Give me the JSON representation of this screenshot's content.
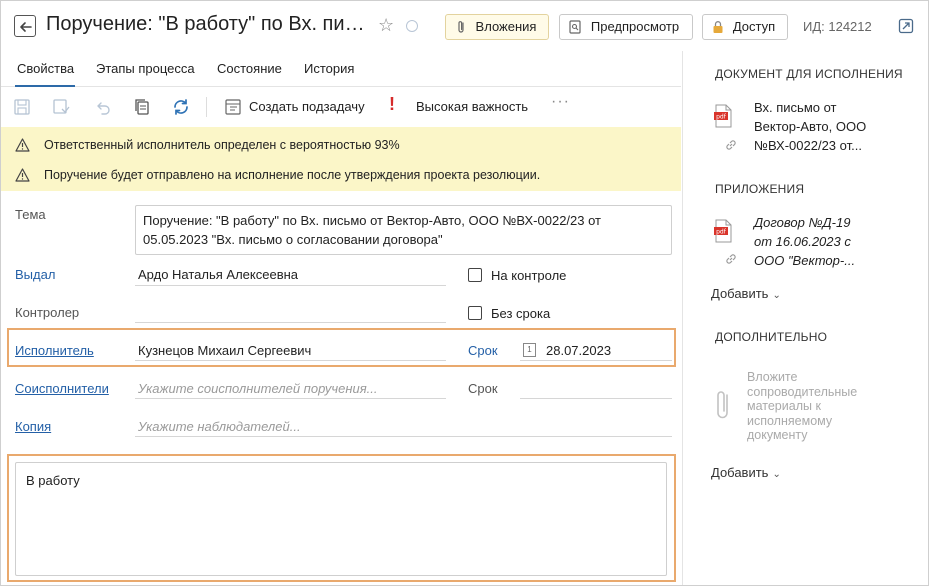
{
  "header": {
    "title": "Поручение: \"В работу\" по Вх. пис...",
    "attachments_label": "Вложения",
    "preview_label": "Предпросмотр",
    "access_label": "Доступ",
    "id_label": "ИД: 124212"
  },
  "tabs": [
    {
      "label": "Свойства",
      "active": true
    },
    {
      "label": "Этапы процесса",
      "active": false
    },
    {
      "label": "Состояние",
      "active": false
    },
    {
      "label": "История",
      "active": false
    }
  ],
  "toolbar": {
    "create_subtask_label": "Создать подзадачу",
    "importance_mark": "!",
    "importance_label": "Высокая важность",
    "more_label": "···"
  },
  "warnings": [
    "Ответственный исполнитель определен с вероятностью 93%",
    "Поручение будет отправлено на исполнение после утверждения проекта резолюции."
  ],
  "form": {
    "subject_label": "Тема",
    "subject_value": "Поручение: \"В работу\" по Вх. письмо от Вектор-Авто, ООО №ВХ-0022/23 от 05.05.2023 \"Вх. письмо о согласовании договора\"",
    "issued_label": "Выдал",
    "issued_value": "Ардо Наталья Алексеевна",
    "on_control_label": "На контроле",
    "controller_label": "Контролер",
    "controller_value": "",
    "no_deadline_label": "Без срока",
    "executor_label": "Исполнитель",
    "executor_value": "Кузнецов Михаил Сергеевич",
    "deadline_label": "Срок",
    "deadline_value": "28.07.2023",
    "calendar_day": "1",
    "coexecutors_label": "Соисполнители",
    "coexecutors_placeholder": "Укажите соисполнителей поручения...",
    "deadline2_label": "Срок",
    "copy_label": "Копия",
    "copy_placeholder": "Укажите наблюдателей...",
    "note_value": "В работу"
  },
  "side": {
    "doc_heading": "ДОКУМЕНТ ДЛЯ ИСПОЛНЕНИЯ",
    "doc_line1": "Вх. письмо от",
    "doc_line2": "Вектор-Авто, ООО",
    "doc_line3": "№ВХ-0022/23 от...",
    "attach_heading": "ПРИЛОЖЕНИЯ",
    "attach_line1": "Договор №Д-19",
    "attach_line2": "от 16.06.2023 с",
    "attach_line3": "ООО \"Вектор-...",
    "add_label": "Добавить",
    "extra_heading": "ДОПОЛНИТЕЛЬНО",
    "drop_hint": "Вложите сопроводительные материалы к исполняемому документу",
    "add_label2": "Добавить",
    "pdf_label": "pdf"
  },
  "colors": {
    "link": "#2460a7",
    "warning_bg": "#fbf6c8",
    "highlight": "#e9a96d",
    "importance": "#d62b2b",
    "pdf_red": "#d9342b"
  }
}
